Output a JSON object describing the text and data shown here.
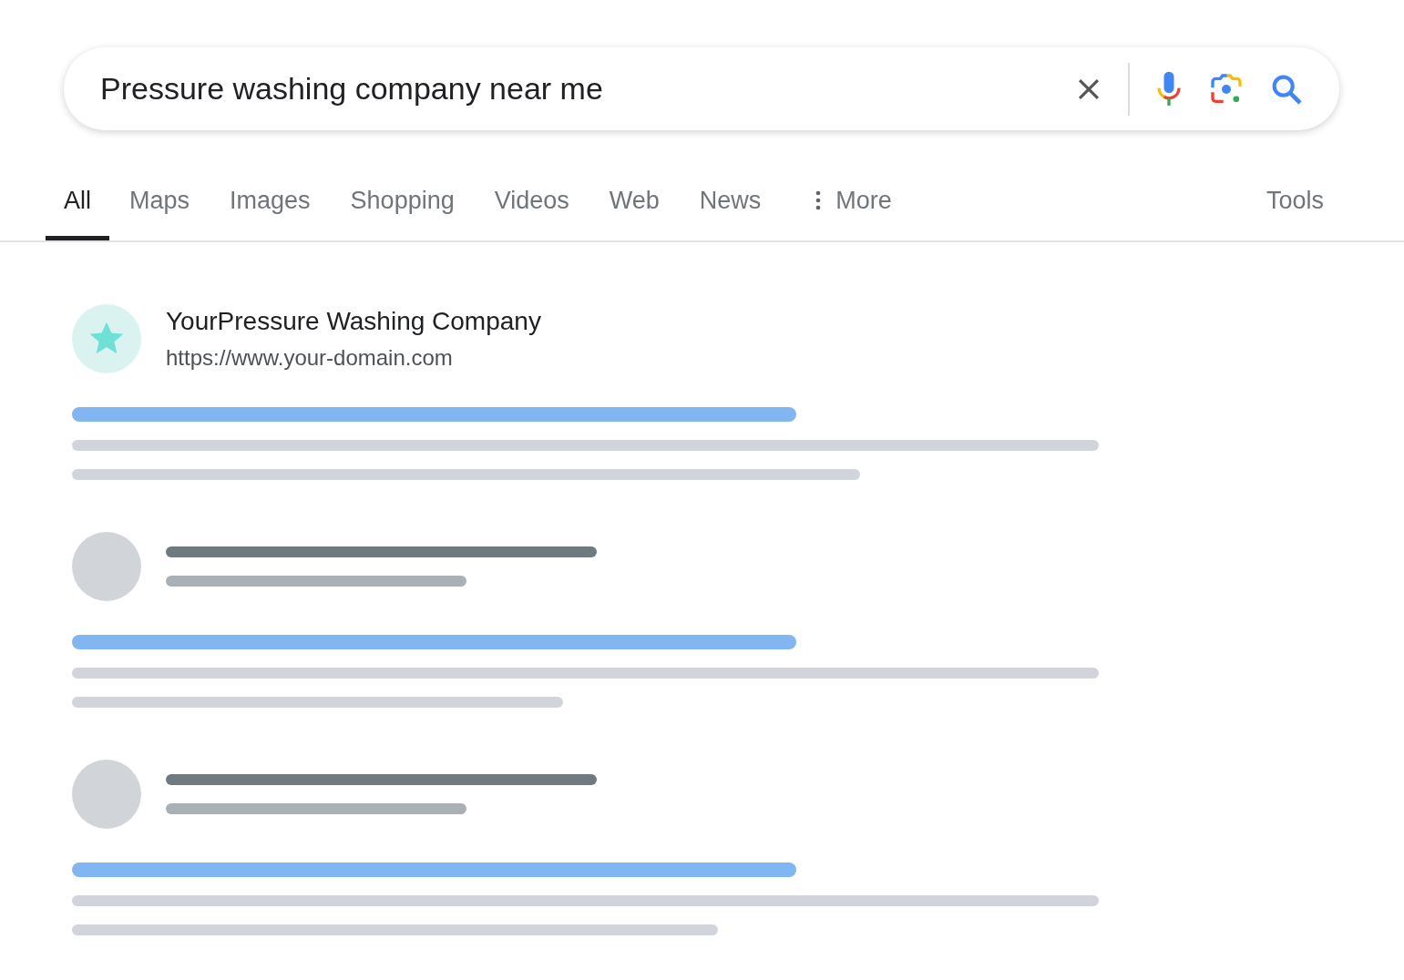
{
  "search": {
    "value": "Pressure washing company near me"
  },
  "tabs": [
    {
      "label": "All",
      "selected": true,
      "kind": "tab"
    },
    {
      "label": "Maps",
      "selected": false,
      "kind": "tab"
    },
    {
      "label": "Images",
      "selected": false,
      "kind": "tab"
    },
    {
      "label": "Shopping",
      "selected": false,
      "kind": "tab"
    },
    {
      "label": "Videos",
      "selected": false,
      "kind": "tab"
    },
    {
      "label": "Web",
      "selected": false,
      "kind": "tab"
    },
    {
      "label": "News",
      "selected": false,
      "kind": "tab"
    },
    {
      "label": "More",
      "selected": false,
      "kind": "more"
    }
  ],
  "tools": "Tools",
  "results": [
    {
      "kind": "listing",
      "title": "YourPressure Washing Company",
      "url": "https://www.your-domain.com"
    },
    {
      "kind": "placeholder"
    },
    {
      "kind": "placeholder"
    }
  ]
}
